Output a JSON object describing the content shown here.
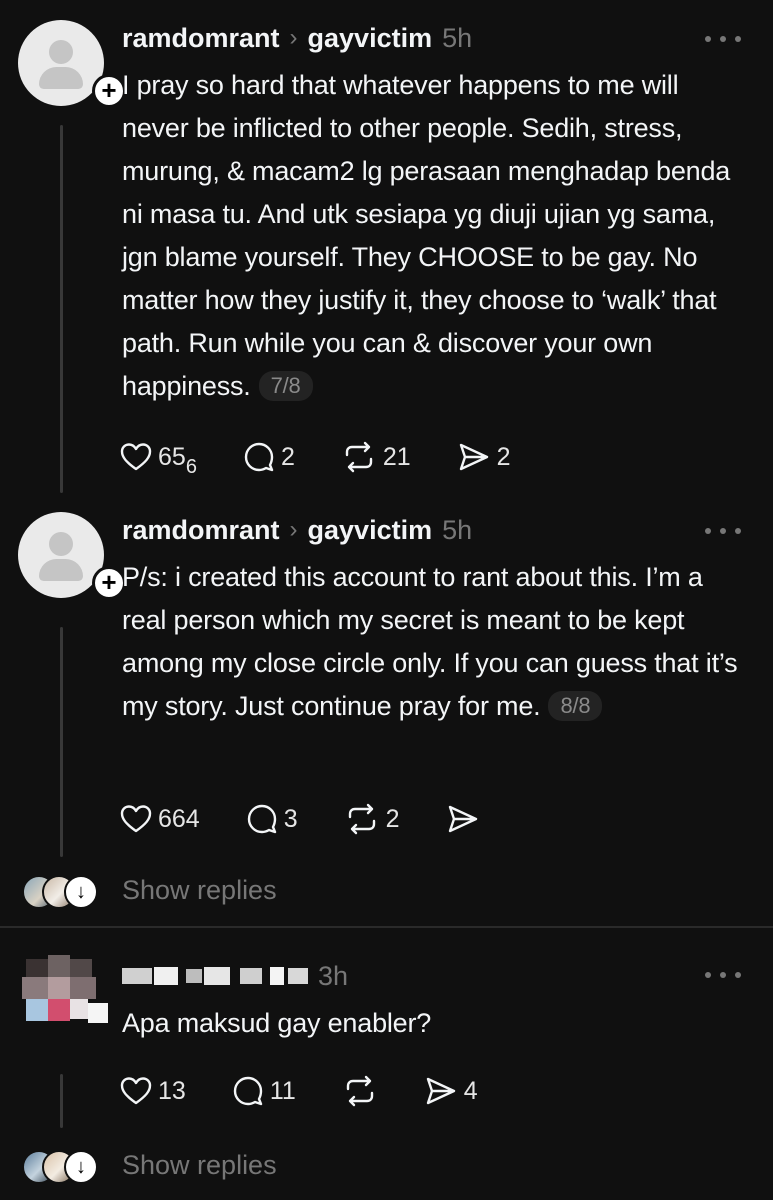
{
  "posts": [
    {
      "username": "ramdomrant",
      "reply_to": "gayvictim",
      "time": "5h",
      "text": "I pray so hard that whatever happens to me will never be inflicted to other people. Sedih, stress, murung, & macam2 lg perasaan menghadap benda ni masa tu. And utk sesiapa yg diuji ujian yg sama, jgn blame yourself. They CHOOSE to be gay. No matter how they justify it, they choose to ‘walk’ that path. Run while you can & discover your own happiness.",
      "page": "7/8",
      "likes": "65",
      "likes_sub": "6",
      "comments": "2",
      "reposts": "21",
      "shares": "2"
    },
    {
      "username": "ramdomrant",
      "reply_to": "gayvictim",
      "time": "5h",
      "text": "P/s: i created this account to rant about this. I’m a real person which my secret is meant to be kept among my close circle only. If you can guess that it’s my story. Just continue pray for me.",
      "page": "8/8",
      "likes": "664",
      "comments": "3",
      "reposts": "2",
      "shares": ""
    }
  ],
  "show_replies_1": "Show replies",
  "reply": {
    "time": "3h",
    "text": "Apa maksud gay enabler?",
    "likes": "13",
    "comments": "11",
    "reposts": "",
    "shares": "4"
  },
  "show_replies_2": "Show replies",
  "icons": {
    "like": "heart-icon",
    "comment": "comment-bubble-icon",
    "repost": "repost-icon",
    "share": "send-icon",
    "more": "more-dots-icon"
  },
  "colors": {
    "background": "#101010",
    "text": "#f3f5f7",
    "muted": "#777777"
  }
}
